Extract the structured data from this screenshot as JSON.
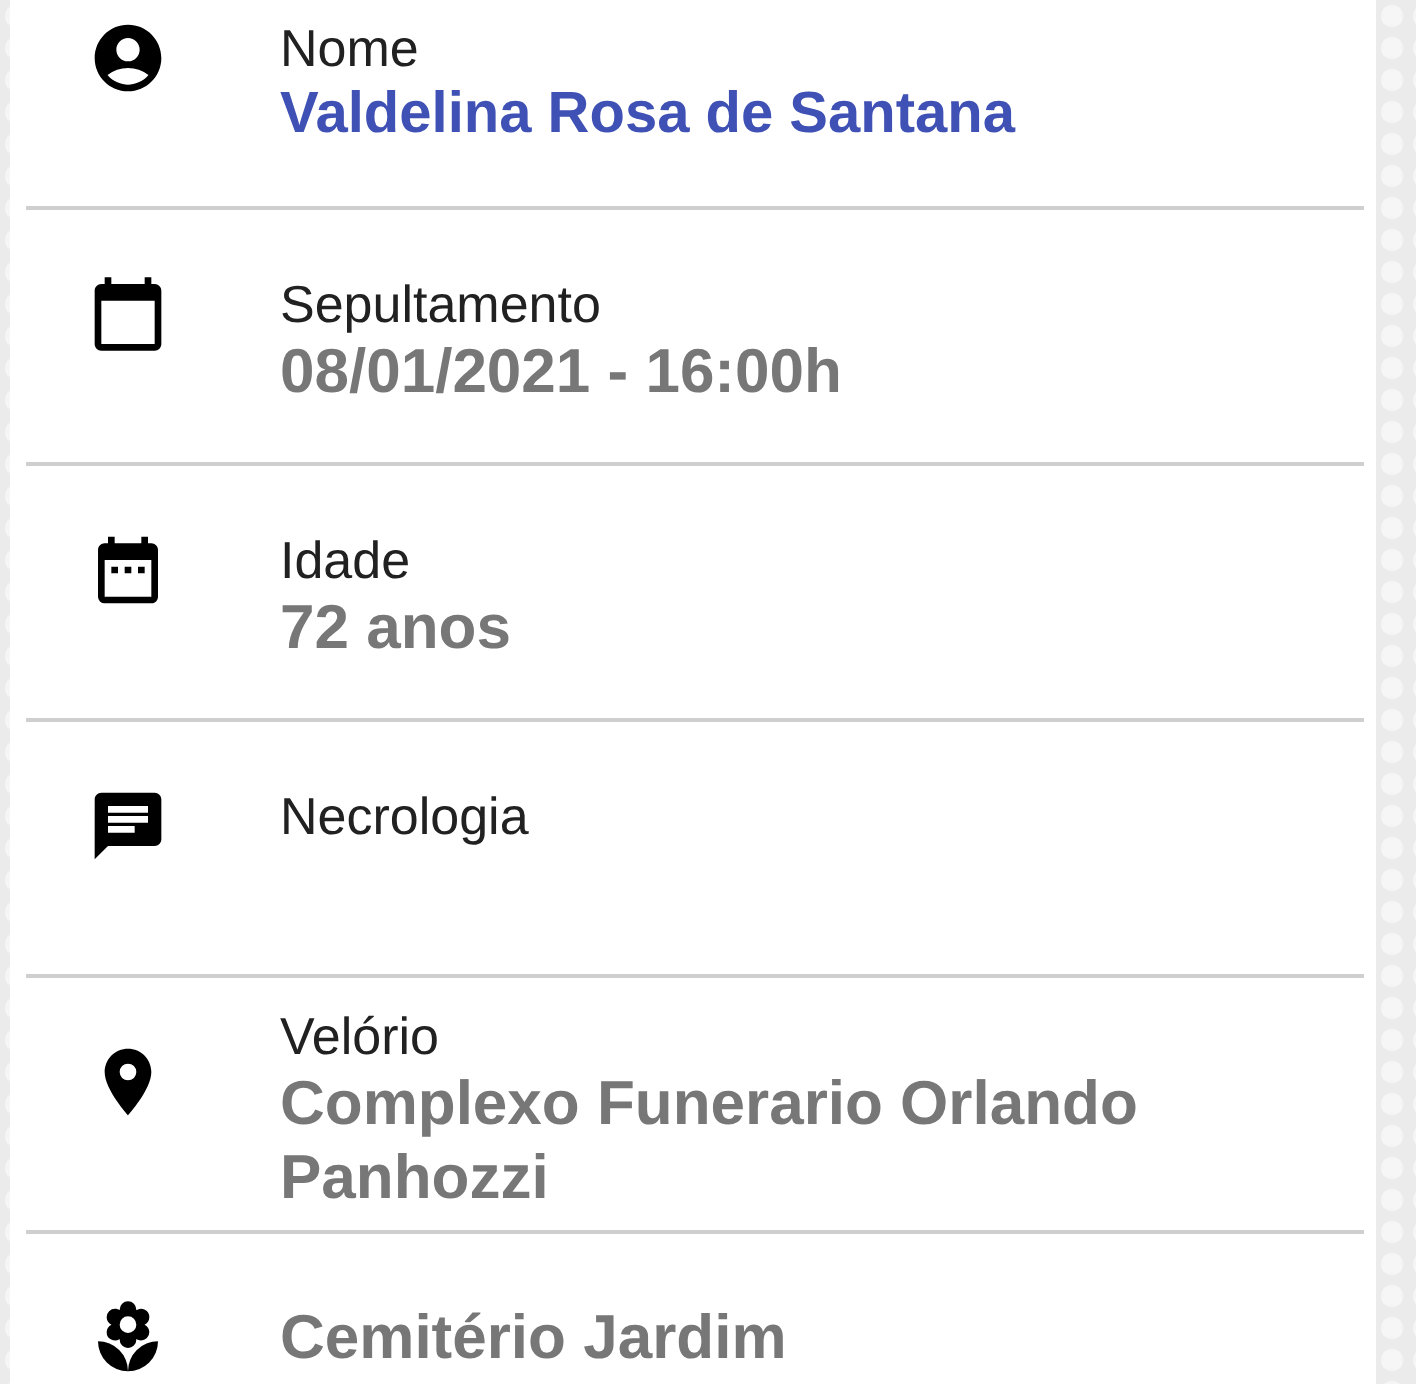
{
  "fields": [
    {
      "kind": "name",
      "label": "Nome",
      "value": "Valdelina Rosa de Santana"
    },
    {
      "kind": "burial",
      "label": "Sepultamento",
      "value": "08/01/2021 - 16:00h"
    },
    {
      "kind": "age",
      "label": "Idade",
      "value": "72 anos"
    },
    {
      "kind": "obituary",
      "label": "Necrologia"
    },
    {
      "kind": "wake",
      "label": "Velório",
      "value": "Complexo Funerario Orlando Panhozzi"
    },
    {
      "kind": "cemetery",
      "value": "Cemitério Jardim"
    }
  ]
}
